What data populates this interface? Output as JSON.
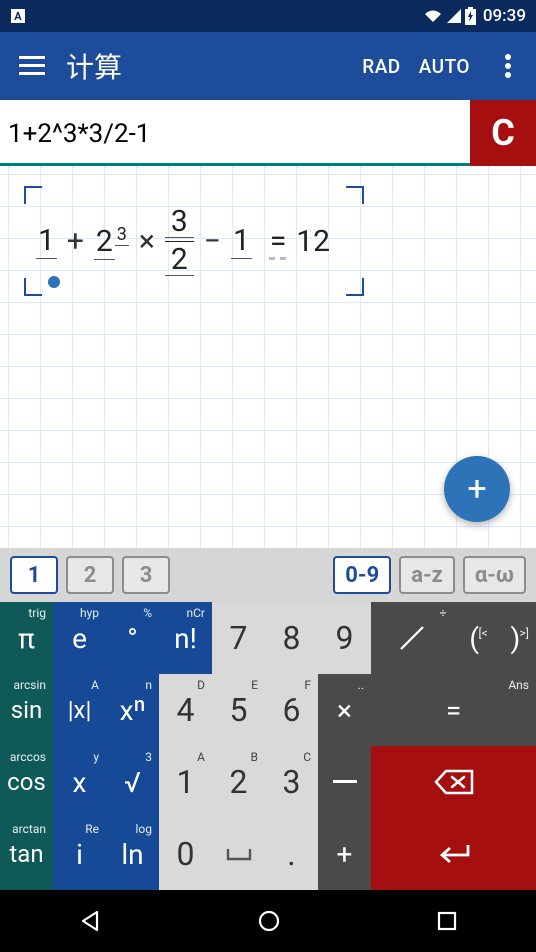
{
  "status": {
    "time": "09:39",
    "icons": [
      "wifi",
      "signal",
      "battery-charging"
    ]
  },
  "appbar": {
    "title": "计算",
    "rad": "RAD",
    "auto": "AUTO"
  },
  "input": {
    "expression": "1+2^3*3/2-1",
    "clear": "C"
  },
  "math": {
    "tokens": {
      "one": "1",
      "plus": "+",
      "two": "2",
      "exp": "3",
      "times": "×",
      "fnum": "3",
      "fden": "2",
      "minus": "−",
      "one2": "1",
      "eq": "=",
      "result": "12"
    }
  },
  "fab": {
    "label": "+"
  },
  "tabs": {
    "t1": "1",
    "t2": "2",
    "t3": "3",
    "num": "0-9",
    "az": "a-z",
    "greek": "α-ω"
  },
  "keys": {
    "pi": "π",
    "e": "e",
    "deg": "°",
    "nfact": "n!",
    "seven": "7",
    "eight": "8",
    "nine": "9",
    "div": "⁄",
    "lp": "(",
    "rp": ")",
    "sin": "sin",
    "abs": "|x|",
    "xn": "xⁿ",
    "four": "4",
    "five": "5",
    "six": "6",
    "mul": "×",
    "eqk": "=",
    "cos": "cos",
    "x": "x",
    "sqrt": "√",
    "one": "1",
    "two": "2",
    "three": "3",
    "bksp": "⌫",
    "tan": "tan",
    "i": "i",
    "ln": "ln",
    "zero": "0",
    "space": "␣",
    "dot": ".",
    "plus": "+",
    "enter": "↵",
    "hints": {
      "trig": "trig",
      "hyp": "hyp",
      "pct": "%",
      "ncr": "nCr",
      "arcsin": "arcsin",
      "A": "A",
      "smalln": "n",
      "D": "D",
      "E": "E",
      "F": "F",
      "dotdot": "..",
      "Ans": "Ans",
      "arccos": "arccos",
      "y": "y",
      "h3": "3",
      "Ah": "A",
      "B": "B",
      "C": "C",
      "arctan": "arctan",
      "Re": "Re",
      "log": "log",
      "divh": "÷",
      "lbr": "[<",
      "rbr": ">]"
    }
  }
}
